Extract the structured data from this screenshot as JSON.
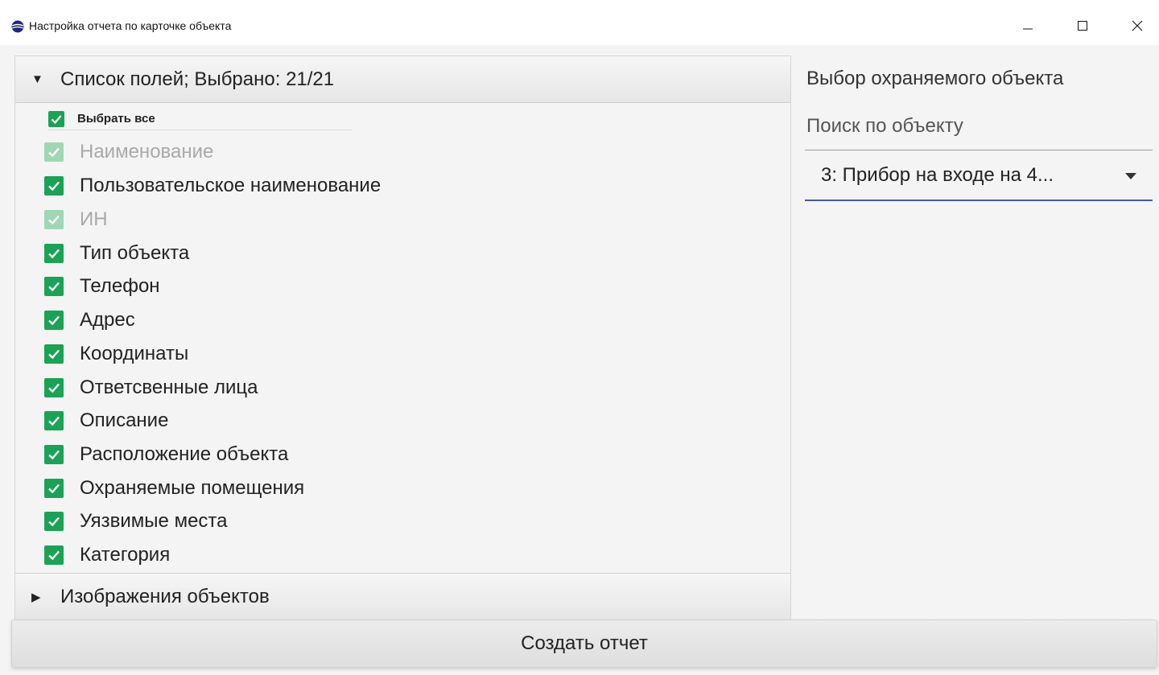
{
  "window": {
    "title": "Настройка отчета по карточке объекта",
    "minimize_icon": "minimize-icon",
    "maximize_icon": "maximize-icon",
    "close_icon": "close-icon"
  },
  "fields_pane": {
    "header": "Список полей; Выбрано: 21/21",
    "expanded": true,
    "select_all_label": "Выбрать все",
    "select_all_checked": true,
    "items": [
      {
        "label": "Наименование",
        "checked": true,
        "disabled": true
      },
      {
        "label": "Пользовательское наименование",
        "checked": true,
        "disabled": false
      },
      {
        "label": "ИН",
        "checked": true,
        "disabled": true
      },
      {
        "label": "Тип объекта",
        "checked": true,
        "disabled": false
      },
      {
        "label": "Телефон",
        "checked": true,
        "disabled": false
      },
      {
        "label": "Адрес",
        "checked": true,
        "disabled": false
      },
      {
        "label": "Координаты",
        "checked": true,
        "disabled": false
      },
      {
        "label": "Ответсвенные лица",
        "checked": true,
        "disabled": false
      },
      {
        "label": "Описание",
        "checked": true,
        "disabled": false
      },
      {
        "label": "Расположение объекта",
        "checked": true,
        "disabled": false
      },
      {
        "label": "Охраняемые помещения",
        "checked": true,
        "disabled": false
      },
      {
        "label": "Уязвимые места",
        "checked": true,
        "disabled": false
      },
      {
        "label": "Категория",
        "checked": true,
        "disabled": false
      }
    ]
  },
  "images_pane": {
    "header": "Изображения объектов",
    "expanded": false
  },
  "object_selection": {
    "title": "Выбор охраняемого объекта",
    "search_placeholder": "Поиск по объекту",
    "selected_value": "3: Прибор на входе на 4..."
  },
  "create_button_label": "Создать отчет",
  "colors": {
    "checkbox_checked": "#1aa355",
    "checkbox_disabled": "#9fd7b4",
    "combo_underline": "#4b55a4",
    "app_icon": "#1f2a7a"
  }
}
